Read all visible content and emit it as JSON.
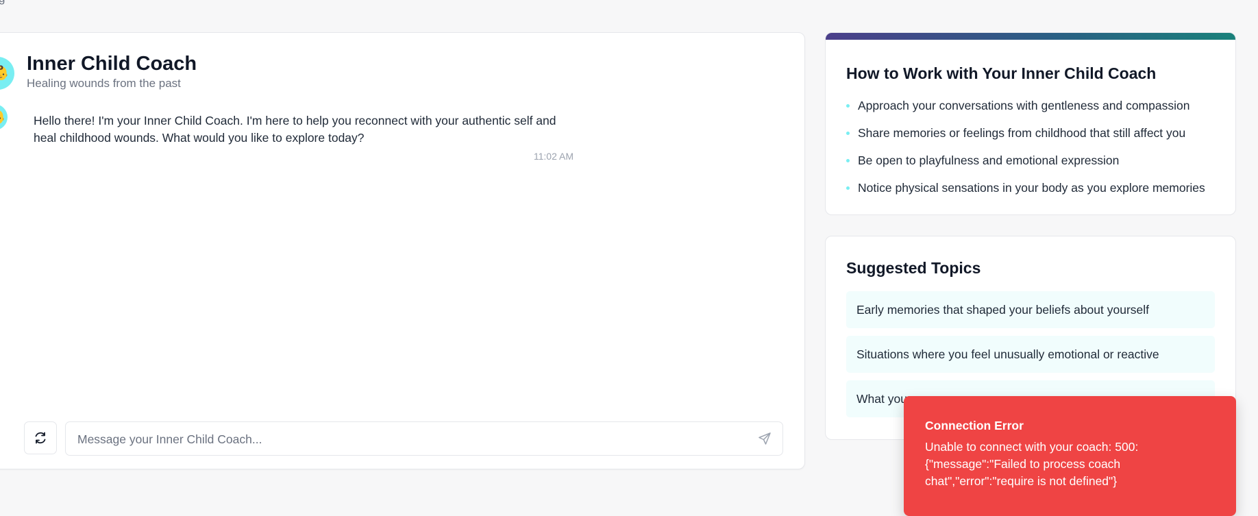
{
  "chat": {
    "coach_name": "Inner Child Coach",
    "coach_subtitle": "Healing wounds from the past",
    "avatar_emoji": "👶",
    "messages": [
      {
        "text": "Hello there! I'm your Inner Child Coach. I'm here to help you reconnect with your authentic self and heal childhood wounds. What would you like to explore today?",
        "time": "11:02 AM",
        "avatar_emoji": "👶"
      }
    ],
    "input": {
      "placeholder": "Message your Inner Child Coach..."
    }
  },
  "tips": {
    "title": "How to Work with Your Inner Child Coach",
    "items": [
      "Approach your conversations with gentleness and compassion",
      "Share memories or feelings from childhood that still affect you",
      "Be open to playfulness and emotional expression",
      "Notice physical sensations in your body as you explore memories"
    ]
  },
  "topics": {
    "title": "Suggested Topics",
    "items": [
      "Early memories that shaped your beliefs about yourself",
      "Situations where you feel unusually emotional or reactive",
      "What you"
    ]
  },
  "toast": {
    "title": "Connection Error",
    "message": "Unable to connect with your coach: 500: {\"message\":\"Failed to process coach chat\",\"error\":\"require is not defined\"}"
  },
  "colors": {
    "accent_cyan": "#79eef2",
    "toast_red": "#ef4444",
    "topic_bg": "#f1fdfd",
    "gradient_start": "#4b3f8a",
    "gradient_end": "#1a817b"
  },
  "icons": {
    "mic": "microphone-icon",
    "refresh": "refresh-icon",
    "send": "send-icon"
  }
}
